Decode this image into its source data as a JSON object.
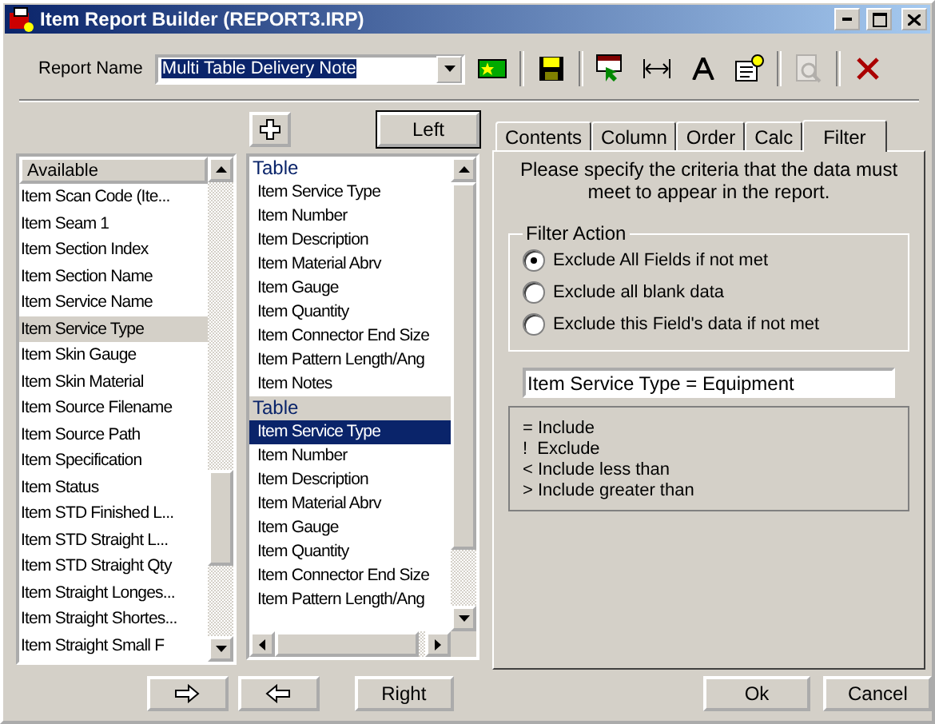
{
  "window": {
    "title": "Item Report Builder (REPORT3.IRP)"
  },
  "report_name": {
    "label": "Report Name",
    "value": "Multi Table Delivery Note"
  },
  "toolbar": [
    {
      "kind": "new",
      "disabled": false
    },
    {
      "kind": "save",
      "disabled": false
    },
    {
      "kind": "pick",
      "disabled": false
    },
    {
      "kind": "width",
      "disabled": false
    },
    {
      "kind": "font",
      "disabled": false
    },
    {
      "kind": "props",
      "disabled": false
    },
    {
      "kind": "preview",
      "disabled": true
    },
    {
      "kind": "delete",
      "disabled": false
    }
  ],
  "left_button": "Left",
  "available": {
    "header": "Available",
    "items": [
      {
        "label": "Item Scan Code (Ite...",
        "selected": false
      },
      {
        "label": "Item Seam 1",
        "selected": false
      },
      {
        "label": "Item Section Index",
        "selected": false
      },
      {
        "label": "Item Section Name",
        "selected": false
      },
      {
        "label": "Item Service Name",
        "selected": false
      },
      {
        "label": "Item Service Type",
        "selected": true
      },
      {
        "label": "Item Skin Gauge",
        "selected": false
      },
      {
        "label": "Item Skin Material",
        "selected": false
      },
      {
        "label": "Item Source Filename",
        "selected": false
      },
      {
        "label": "Item Source Path",
        "selected": false
      },
      {
        "label": "Item Specification",
        "selected": false
      },
      {
        "label": "Item Status",
        "selected": false
      },
      {
        "label": "Item STD Finished L...",
        "selected": false
      },
      {
        "label": "Item STD Straight L...",
        "selected": false
      },
      {
        "label": "Item STD Straight Qty",
        "selected": false
      },
      {
        "label": "Item Straight Longes...",
        "selected": false
      },
      {
        "label": "Item Straight Shortes...",
        "selected": false
      },
      {
        "label": "Item Straight Small F",
        "selected": false
      }
    ]
  },
  "report_tables": [
    {
      "title": "Table",
      "items": [
        {
          "label": "Item Service Type",
          "selected": false
        },
        {
          "label": "Item Number",
          "selected": false
        },
        {
          "label": "Item Description",
          "selected": false
        },
        {
          "label": "Item Material Abrv",
          "selected": false
        },
        {
          "label": "Item Gauge",
          "selected": false
        },
        {
          "label": "Item Quantity",
          "selected": false
        },
        {
          "label": "Item Connector End Size",
          "selected": false
        },
        {
          "label": "Item Pattern Length/Ang",
          "selected": false
        },
        {
          "label": "Item Notes",
          "selected": false
        }
      ]
    },
    {
      "title": "Table",
      "items": [
        {
          "label": "Item Service Type",
          "selected": true
        },
        {
          "label": "Item Number",
          "selected": false
        },
        {
          "label": "Item Description",
          "selected": false
        },
        {
          "label": "Item Material Abrv",
          "selected": false
        },
        {
          "label": "Item Gauge",
          "selected": false
        },
        {
          "label": "Item Quantity",
          "selected": false
        },
        {
          "label": "Item Connector End Size",
          "selected": false
        },
        {
          "label": "Item Pattern Length/Ang",
          "selected": false
        }
      ]
    }
  ],
  "tabs": [
    {
      "label": "Contents",
      "selected": false
    },
    {
      "label": "Column",
      "selected": false
    },
    {
      "label": "Order",
      "selected": false
    },
    {
      "label": "Calc",
      "selected": false
    },
    {
      "label": "Filter",
      "selected": true
    }
  ],
  "filter": {
    "instruction": "Please specify the criteria that the data must meet to appear in the report.",
    "group_title": "Filter Action",
    "options": [
      {
        "label": "Exclude All Fields if not met",
        "selected": true
      },
      {
        "label": "Exclude all blank data",
        "selected": false
      },
      {
        "label": "Exclude this Field's data if not met",
        "selected": false
      }
    ],
    "criteria": "Item Service Type = Equipment",
    "legend": [
      "= Include",
      "!  Exclude",
      "< Include less than",
      "> Include greater than"
    ]
  },
  "bottom_buttons": {
    "right": "Right",
    "ok": "Ok",
    "cancel": "Cancel"
  }
}
